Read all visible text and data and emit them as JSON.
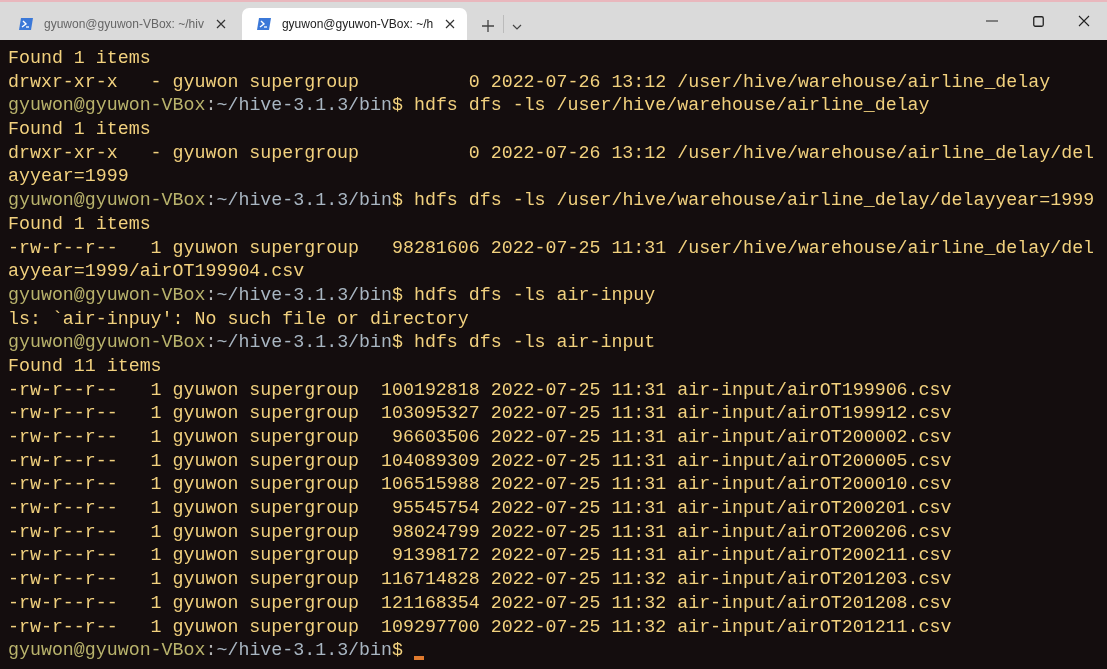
{
  "tabs": [
    {
      "title": "gyuwon@gyuwon-VBox: ~/hiv",
      "selected": false
    },
    {
      "title": "gyuwon@gyuwon-VBox: ~/h",
      "selected": true
    }
  ],
  "lines": [
    {
      "kind": "output",
      "text": "Found 1 items"
    },
    {
      "kind": "output",
      "text": "drwxr-xr-x   - gyuwon supergroup          0 2022-07-26 13:12 /user/hive/warehouse/airline_delay"
    },
    {
      "kind": "prompt",
      "user": "gyuwon@gyuwon-VBox",
      "sep": ":",
      "path": "~/hive-3.1.3/bin",
      "command": "$ hdfs dfs -ls /user/hive/warehouse/airline_delay"
    },
    {
      "kind": "output",
      "text": "Found 1 items"
    },
    {
      "kind": "output",
      "text": "drwxr-xr-x   - gyuwon supergroup          0 2022-07-26 13:12 /user/hive/warehouse/airline_delay/del"
    },
    {
      "kind": "output",
      "text": "ayyear=1999"
    },
    {
      "kind": "prompt",
      "user": "gyuwon@gyuwon-VBox",
      "sep": ":",
      "path": "~/hive-3.1.3/bin",
      "command": "$ hdfs dfs -ls /user/hive/warehouse/airline_delay/delayyear=1999"
    },
    {
      "kind": "output",
      "text": "Found 1 items"
    },
    {
      "kind": "output",
      "text": "-rw-r--r--   1 gyuwon supergroup   98281606 2022-07-25 11:31 /user/hive/warehouse/airline_delay/del"
    },
    {
      "kind": "output",
      "text": "ayyear=1999/airOT199904.csv"
    },
    {
      "kind": "prompt",
      "user": "gyuwon@gyuwon-VBox",
      "sep": ":",
      "path": "~/hive-3.1.3/bin",
      "command": "$ hdfs dfs -ls air-inpuy"
    },
    {
      "kind": "output",
      "text": "ls: `air-inpuy': No such file or directory"
    },
    {
      "kind": "prompt",
      "user": "gyuwon@gyuwon-VBox",
      "sep": ":",
      "path": "~/hive-3.1.3/bin",
      "command": "$ hdfs dfs -ls air-input"
    },
    {
      "kind": "output",
      "text": "Found 11 items"
    },
    {
      "kind": "output",
      "text": "-rw-r--r--   1 gyuwon supergroup  100192818 2022-07-25 11:31 air-input/airOT199906.csv"
    },
    {
      "kind": "output",
      "text": "-rw-r--r--   1 gyuwon supergroup  103095327 2022-07-25 11:31 air-input/airOT199912.csv"
    },
    {
      "kind": "output",
      "text": "-rw-r--r--   1 gyuwon supergroup   96603506 2022-07-25 11:31 air-input/airOT200002.csv"
    },
    {
      "kind": "output",
      "text": "-rw-r--r--   1 gyuwon supergroup  104089309 2022-07-25 11:31 air-input/airOT200005.csv"
    },
    {
      "kind": "output",
      "text": "-rw-r--r--   1 gyuwon supergroup  106515988 2022-07-25 11:31 air-input/airOT200010.csv"
    },
    {
      "kind": "output",
      "text": "-rw-r--r--   1 gyuwon supergroup   95545754 2022-07-25 11:31 air-input/airOT200201.csv"
    },
    {
      "kind": "output",
      "text": "-rw-r--r--   1 gyuwon supergroup   98024799 2022-07-25 11:31 air-input/airOT200206.csv"
    },
    {
      "kind": "output",
      "text": "-rw-r--r--   1 gyuwon supergroup   91398172 2022-07-25 11:31 air-input/airOT200211.csv"
    },
    {
      "kind": "output",
      "text": "-rw-r--r--   1 gyuwon supergroup  116714828 2022-07-25 11:32 air-input/airOT201203.csv"
    },
    {
      "kind": "output",
      "text": "-rw-r--r--   1 gyuwon supergroup  121168354 2022-07-25 11:32 air-input/airOT201208.csv"
    },
    {
      "kind": "output",
      "text": "-rw-r--r--   1 gyuwon supergroup  109297700 2022-07-25 11:32 air-input/airOT201211.csv"
    },
    {
      "kind": "prompt",
      "user": "gyuwon@gyuwon-VBox",
      "sep": ":",
      "path": "~/hive-3.1.3/bin",
      "command": "$",
      "cursor": true
    }
  ]
}
